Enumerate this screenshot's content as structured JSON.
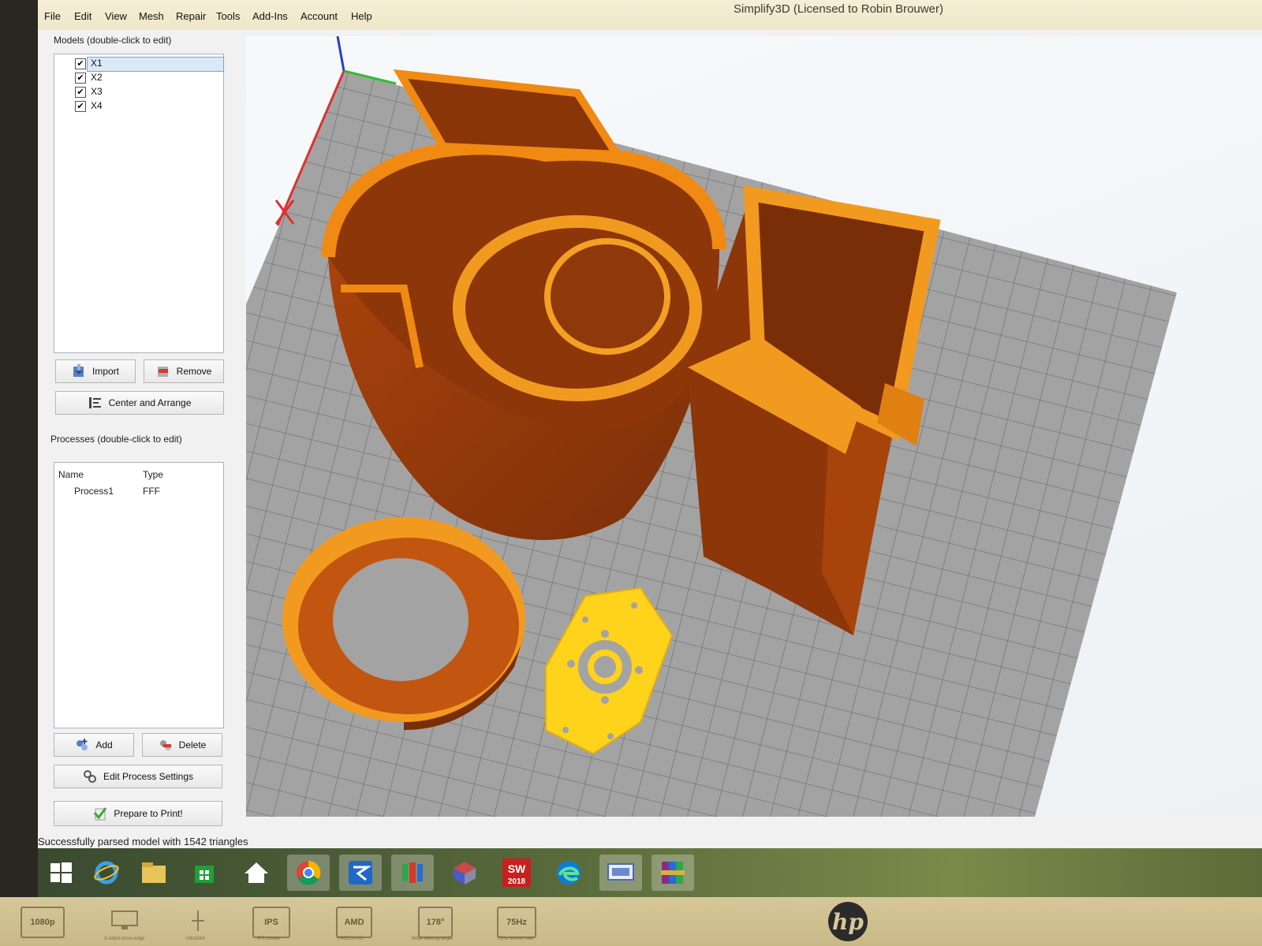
{
  "window": {
    "title": "Simplify3D (Licensed to Robin Brouwer)"
  },
  "menu": [
    "File",
    "Edit",
    "View",
    "Mesh",
    "Repair",
    "Tools",
    "Add-Ins",
    "Account",
    "Help"
  ],
  "models": {
    "title": "Models (double-click to edit)",
    "items": [
      {
        "label": "X1",
        "checked": true,
        "selected": true
      },
      {
        "label": "X2",
        "checked": true,
        "selected": false
      },
      {
        "label": "X3",
        "checked": true,
        "selected": false
      },
      {
        "label": "X4",
        "checked": true,
        "selected": false
      }
    ],
    "import_label": "Import",
    "remove_label": "Remove",
    "center_label": "Center and Arrange"
  },
  "processes": {
    "title": "Processes (double-click to edit)",
    "columns": [
      "Name",
      "Type"
    ],
    "rows": [
      {
        "name": "Process1",
        "type": "FFF"
      }
    ],
    "add_label": "Add",
    "delete_label": "Delete",
    "edit_label": "Edit Process Settings",
    "prepare_label": "Prepare to Print!"
  },
  "status": "Successfully parsed model with 1542 triangles",
  "taskbar": {
    "icons": [
      "windows-start-icon",
      "internet-explorer-icon",
      "file-explorer-icon",
      "store-icon",
      "home-icon",
      "chrome-icon",
      "simplify3d-icon",
      "app-icon",
      "cube-icon",
      "solidworks-icon",
      "edge-icon",
      "network-app-icon",
      "winrar-icon"
    ],
    "solidworks_label": "2018"
  },
  "bezel": {
    "stickers": [
      {
        "label": "1080p",
        "caption": ""
      },
      {
        "label": "",
        "caption": "3-sided micro-edge"
      },
      {
        "label": "",
        "caption": "UltraSlim"
      },
      {
        "label": "IPS",
        "caption": "IPS screen"
      },
      {
        "label": "AMD",
        "caption": "FREESYNC"
      },
      {
        "label": "178°",
        "caption": "Wide viewing angle"
      },
      {
        "label": "75Hz",
        "caption": "75Hz refresh rate"
      }
    ],
    "brand": "hp"
  },
  "colors": {
    "model_orange": "#f08a12",
    "model_dark": "#8a3a0c",
    "plate_yellow": "#ffd21c",
    "bed_grey": "#9e9e9e",
    "grid_line": "#6e6e6e",
    "axis_x": "#e03030",
    "axis_y": "#30c030",
    "axis_z": "#2040d0"
  }
}
